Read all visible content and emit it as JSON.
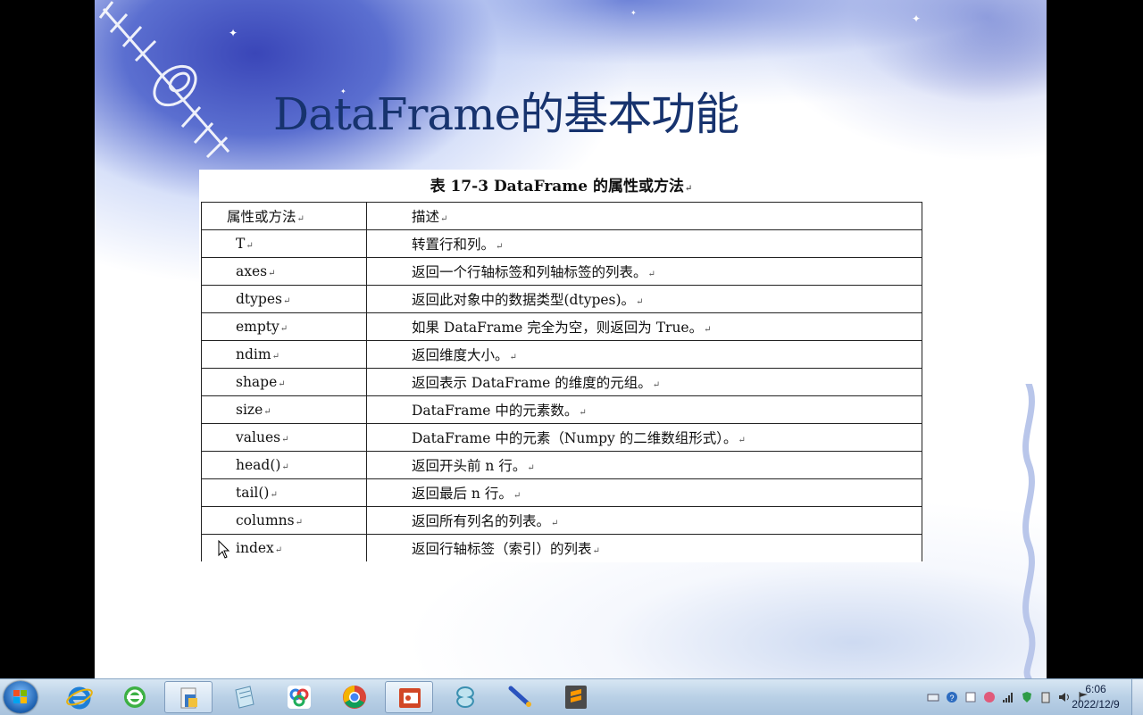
{
  "slide": {
    "title": "DataFrame的基本功能"
  },
  "table": {
    "caption": "表 17-3    DataFrame 的属性或方法",
    "header": [
      "属性或方法",
      "描述"
    ],
    "rows": [
      [
        "T",
        "转置行和列。"
      ],
      [
        "axes",
        "返回一个行轴标签和列轴标签的列表。"
      ],
      [
        "dtypes",
        "返回此对象中的数据类型(dtypes)。"
      ],
      [
        "empty",
        "如果 DataFrame 完全为空，则返回为 True。"
      ],
      [
        "ndim",
        "返回维度大小。"
      ],
      [
        "shape",
        "返回表示 DataFrame 的维度的元组。"
      ],
      [
        "size",
        "DataFrame 中的元素数。"
      ],
      [
        "values",
        "DataFrame 中的元素（Numpy 的二维数组形式）。"
      ],
      [
        "head()",
        "返回开头前 n 行。"
      ],
      [
        "tail()",
        "返回最后 n 行。"
      ],
      [
        "columns",
        "返回所有列名的列表。"
      ],
      [
        "index",
        "返回行轴标签（索引）的列表"
      ]
    ]
  },
  "taskbar": {
    "apps": [
      "internet-explorer",
      "360-browser",
      "file-explorer",
      "notepad",
      "baidu-netdisk",
      "chrome",
      "powerpoint",
      "network-tool",
      "pen-tool",
      "sublime-text"
    ],
    "active_apps": [
      "file-explorer",
      "powerpoint"
    ],
    "clock": {
      "time": "6:06",
      "date": "2022/12/9"
    }
  },
  "colors": {
    "title": "#17336e",
    "taskbar": "#b9d0e6"
  }
}
